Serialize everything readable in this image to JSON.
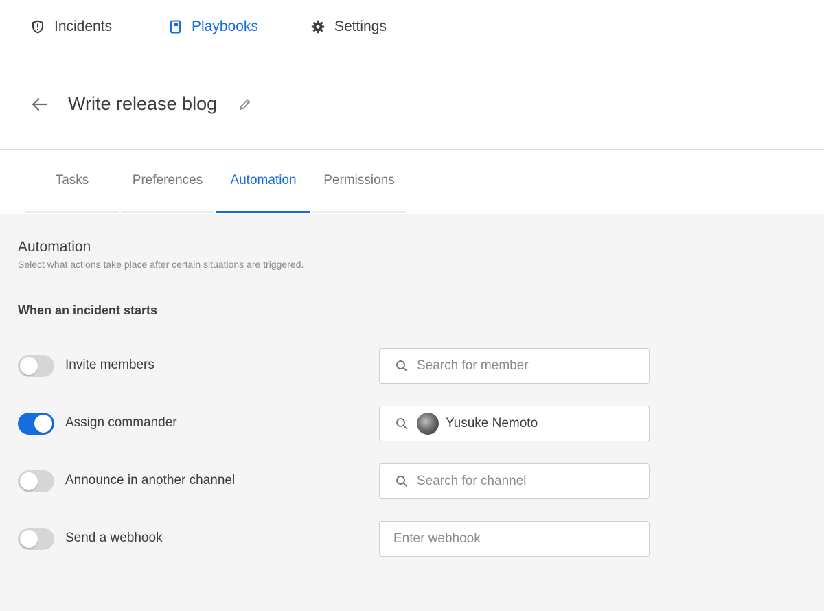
{
  "nav": {
    "items": [
      {
        "label": "Incidents",
        "icon": "shield-alert-icon",
        "active": false
      },
      {
        "label": "Playbooks",
        "icon": "notebook-icon",
        "active": true
      },
      {
        "label": "Settings",
        "icon": "gear-icon",
        "active": false
      }
    ]
  },
  "header": {
    "title": "Write release blog"
  },
  "tabs": [
    {
      "label": "Tasks",
      "active": false
    },
    {
      "label": "Preferences",
      "active": false
    },
    {
      "label": "Automation",
      "active": true
    },
    {
      "label": "Permissions",
      "active": false
    }
  ],
  "automation": {
    "title": "Automation",
    "subtitle": "Select what actions take place after certain situations are triggered.",
    "group_title": "When an incident starts",
    "rows": [
      {
        "label": "Invite members",
        "enabled": false,
        "field_placeholder": "Search for member",
        "field_value": ""
      },
      {
        "label": "Assign commander",
        "enabled": true,
        "field_placeholder": "",
        "field_value": "Yusuke Nemoto"
      },
      {
        "label": "Announce in another channel",
        "enabled": false,
        "field_placeholder": "Search for channel",
        "field_value": ""
      },
      {
        "label": "Send a webhook",
        "enabled": false,
        "field_placeholder": "Enter webhook",
        "field_value": ""
      }
    ]
  },
  "colors": {
    "accent": "#166de0",
    "text": "#3d3c40",
    "muted": "#8b8b8e",
    "content_bg": "#f5f5f5",
    "toggle_off": "#d6d6d8"
  }
}
